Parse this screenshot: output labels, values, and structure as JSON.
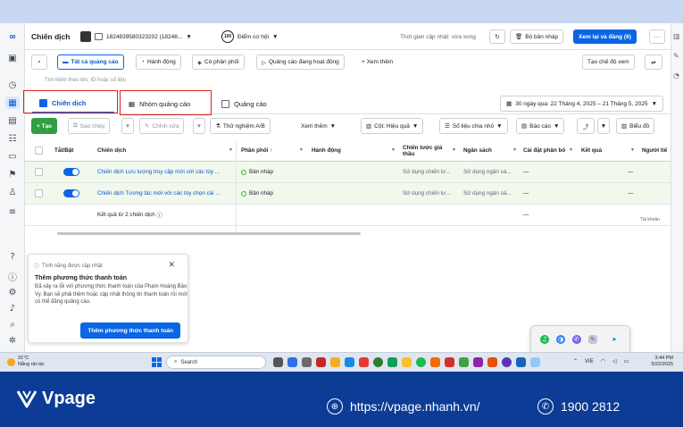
{
  "header": {
    "title": "Chiến dịch",
    "account_id": "1824839580323202 (18248...",
    "opportunity": "Điểm cơ hội",
    "opportunity_score": "100",
    "updated": "Thời gian cập nhật: vừa xong",
    "discard_label": "Bỏ bản nháp",
    "publish_label": "Xem lại và đăng (6)",
    "more_label": "···"
  },
  "filters": {
    "all_ads": "Tất cả quảng cáo",
    "action": "Hành động",
    "has_delivery": "Có phân phối",
    "active_ads": "Quảng cáo đang hoạt động",
    "see_more": "+ Xem thêm",
    "create_view": "Tạo chế độ xem"
  },
  "search": {
    "placeholder": "Tìm kiếm theo tên, ID hoặc số liệu"
  },
  "tabs": {
    "campaigns": "Chiến dịch",
    "adsets": "Nhóm quảng cáo",
    "ads": "Quảng cáo",
    "date_range": "30 ngày qua: 22 Tháng 4, 2025 – 21 Tháng 5, 2025"
  },
  "actions": {
    "create": "+ Tạo",
    "duplicate": "Sao chép",
    "edit": "Chỉnh sửa",
    "ab_test": "Thử nghiệm A/B",
    "see_more": "Xem thêm",
    "columns": "Cột: Hiệu quả",
    "breakdown": "Số liệu chia nhỏ",
    "reports": "Báo cáo",
    "charts": "Biểu đồ"
  },
  "table": {
    "headers": {
      "toggle": "Tắt/Bật",
      "campaign": "Chiến dịch",
      "delivery": "Phân phối ↑",
      "action": "Hành động",
      "bid_strategy": "Chiến lược giá thầu",
      "budget": "Ngân sách",
      "attribution": "Cài đặt phân bổ",
      "results": "Kết quả",
      "reach": "Người tiế"
    },
    "rows": [
      {
        "name": "Chiến dịch Lưu lượng truy cập mới với các tùy ...",
        "delivery": "Bản nháp",
        "bid": "Sử dụng chiến lư...",
        "budget": "Sử dụng ngân sá...",
        "attribution": "—",
        "results": "—"
      },
      {
        "name": "Chiến dịch Tương tác mới với các tùy chọn cài ...",
        "delivery": "Bản nháp",
        "bid": "Sử dụng chiến lư...",
        "budget": "Sử dụng ngân sá...",
        "attribution": "—",
        "results": "—"
      }
    ],
    "total_label": "Kết quả từ 2 chiến dịch",
    "total_attr": "—",
    "total_note": "Tài khoản"
  },
  "popup": {
    "tag": "Tính năng được cập nhật",
    "title": "Thêm phương thức thanh toán",
    "body": "Đã xảy ra lỗi với phương thức thanh toán của Phạm Hoàng Bảo Vy. Bạn sẽ phải thêm hoặc cập nhật thông tin thanh toán rồi mới có thể đăng quảng cáo.",
    "button": "Thêm phương thức thanh toán"
  },
  "taskbar": {
    "temp": "31°C",
    "weather": "Nắng rải rác",
    "search": "Search",
    "lang": "VIE",
    "time": "3:44 PM",
    "date": "5/22/2025"
  },
  "footer": {
    "brand": "Vpage",
    "url": "https://vpage.nhanh.vn/",
    "phone": "1900 2812"
  },
  "colors": {
    "accent": "#0a66e4",
    "create_button": "#2f9e44",
    "highlight_box": "#e02020",
    "footer_bg": "#0c3c95"
  }
}
